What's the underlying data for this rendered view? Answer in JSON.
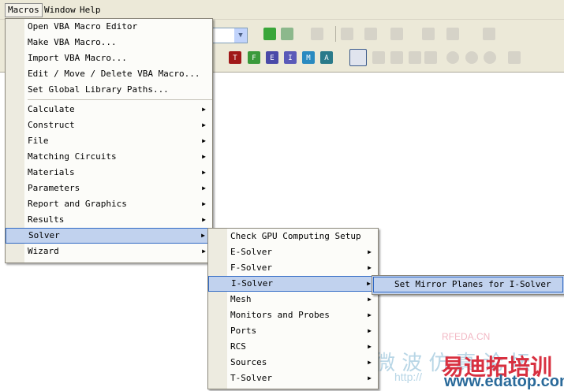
{
  "menubar": {
    "items": [
      {
        "label": "Macros",
        "mn": "a"
      },
      {
        "label": "Window",
        "mn": "d"
      },
      {
        "label": "Help",
        "mn": "H"
      }
    ]
  },
  "macros_menu": {
    "group1": [
      "Open VBA Macro Editor",
      "Make VBA Macro...",
      "Import VBA Macro...",
      "Edit / Move / Delete VBA Macro...",
      "Set Global Library Paths..."
    ],
    "group2": [
      "Calculate",
      "Construct",
      "File",
      "Matching Circuits",
      "Materials",
      "Parameters",
      "Report and Graphics",
      "Results",
      "Solver",
      "Wizard"
    ],
    "selected": "Solver"
  },
  "solver_menu": {
    "items": [
      "Check GPU Computing Setup",
      "E-Solver",
      "F-Solver",
      "I-Solver",
      "Mesh",
      "Monitors and Probes",
      "Ports",
      "RCS",
      "Sources",
      "T-Solver"
    ],
    "selected": "I-Solver"
  },
  "isolver_menu": {
    "items": [
      "Set Mirror Planes for I-Solver"
    ]
  },
  "toolbar": {
    "solver_buttons": [
      {
        "letter": "T",
        "color": "#a01818"
      },
      {
        "letter": "F",
        "color": "#3a9a3a"
      },
      {
        "letter": "E",
        "color": "#4a4aa8"
      },
      {
        "letter": "I",
        "color": "#5a5ab8"
      },
      {
        "letter": "M",
        "color": "#2a8ac0"
      },
      {
        "letter": "A",
        "color": "#2a7a8a"
      }
    ]
  },
  "watermark": {
    "line1": "RFEDA.CN",
    "line2": "易迪拓培训",
    "line3": "www.edatop.com",
    "line4": "http://",
    "line5": "微 波 仿 真 论 坛"
  }
}
